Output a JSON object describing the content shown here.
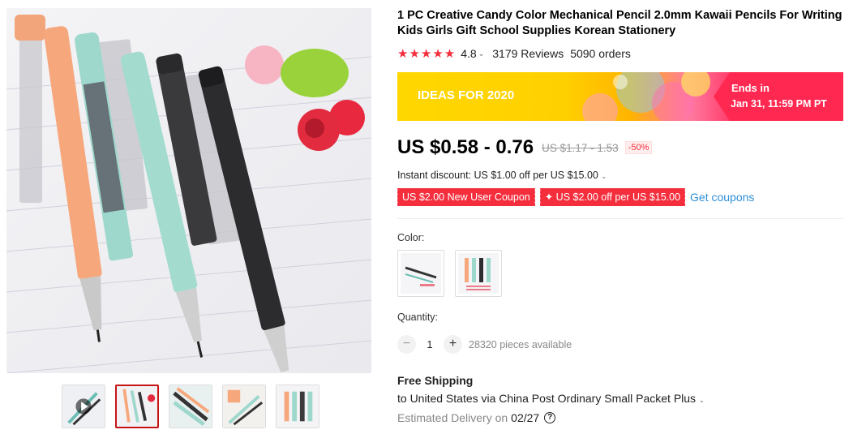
{
  "product": {
    "title": "1 PC Creative Candy Color Mechanical Pencil 2.0mm Kawaii Pencils For Writing Kids Girls Gift School Supplies Korean Stationery",
    "stars": "★★★★★",
    "rating": "4.8",
    "reviews": "3179 Reviews",
    "orders": "5090 orders"
  },
  "banner": {
    "text": "IDEAS FOR 2020",
    "ends_label": "Ends in",
    "ends_time": "Jan 31, 11:59 PM PT"
  },
  "price": {
    "current": "US $0.58 - 0.76",
    "original": "US $1.17 - 1.53",
    "discount": "-50%"
  },
  "instant_discount": "Instant discount: US $1.00 off per US $15.00",
  "coupons": [
    "US $2.00 New User Coupon",
    "✦ US $2.00 off per US $15.00"
  ],
  "get_coupons": "Get coupons",
  "color": {
    "label": "Color:"
  },
  "quantity": {
    "label": "Quantity:",
    "minus": "−",
    "value": "1",
    "plus": "+",
    "available": "28320 pieces available"
  },
  "shipping": {
    "title": "Free Shipping",
    "destination": "to United States via China Post Ordinary Small Packet Plus",
    "delivery_label": "Estimated Delivery on",
    "delivery_date": "02/27",
    "help": "?"
  },
  "icons": {
    "caret": "chevron-down-icon",
    "help": "question-circle-icon"
  },
  "colors": {
    "accent_red": "#f42e3d",
    "link_blue": "#2e8fd8",
    "banner_yellow": "#ffd700",
    "banner_pink": "#ff2851"
  }
}
